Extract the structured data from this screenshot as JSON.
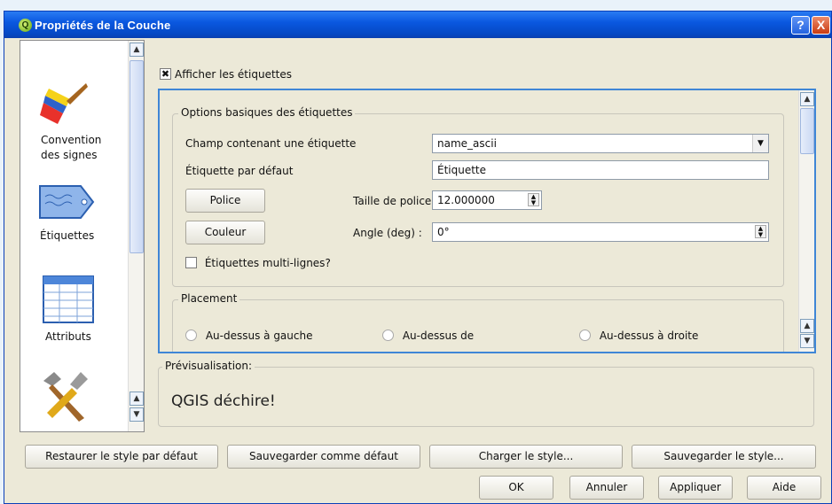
{
  "window": {
    "title": "Propriétés de la Couche",
    "help": "?",
    "close": "X"
  },
  "sidebar": {
    "items": [
      {
        "label_line1": "Convention",
        "label_line2": "des signes",
        "icon": "paintbrush-icon"
      },
      {
        "label_line1": "Étiquettes",
        "label_line2": "",
        "icon": "label-tag-icon"
      },
      {
        "label_line1": "Attributs",
        "label_line2": "",
        "icon": "table-icon"
      },
      {
        "label_line1": "",
        "label_line2": "",
        "icon": "tools-icon"
      }
    ]
  },
  "labels_tab": {
    "show_labels": "Afficher les étiquettes",
    "basic_options_title": "Options basiques des étiquettes",
    "field_label": "Champ contenant une étiquette",
    "field_value": "name_ascii",
    "default_label_label": "Étiquette par défaut",
    "default_label_value": "Étiquette",
    "font_button": "Police",
    "font_size_label": "Taille de police",
    "font_size_value": "12.000000",
    "color_button": "Couleur",
    "angle_label": "Angle (deg) :",
    "angle_value": "0°",
    "multiline_label": "Étiquettes multi-lignes?",
    "placement_title": "Placement",
    "placement_options": [
      "Au-dessus à gauche",
      "Au-dessus de",
      "Au-dessus à droite"
    ]
  },
  "preview": {
    "title": "Prévisualisation:",
    "text": "QGIS déchire!"
  },
  "style_buttons": {
    "restore": "Restaurer le style par défaut",
    "save_default": "Sauvegarder comme défaut",
    "load": "Charger le style...",
    "save": "Sauvegarder le style..."
  },
  "dialog_buttons": {
    "ok": "OK",
    "cancel": "Annuler",
    "apply": "Appliquer",
    "help": "Aide"
  }
}
